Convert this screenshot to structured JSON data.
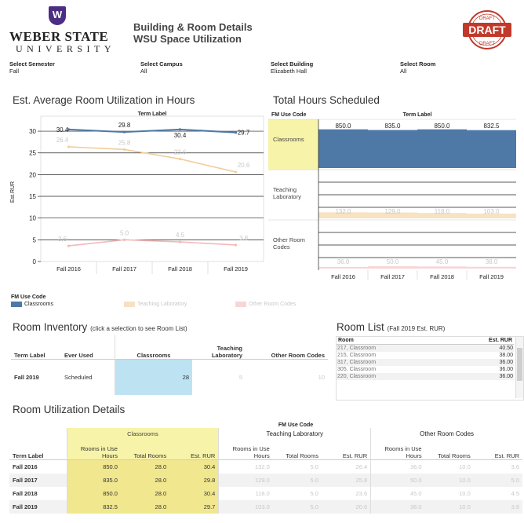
{
  "header": {
    "logo_name": "WEBER STATE",
    "logo_sub": "UNIVERSITY",
    "logo_letter": "W",
    "title1": "Building & Room Details",
    "title2": "WSU Space Utilization",
    "draft_stamp": "DRAFT",
    "draft_small": "DRAFT"
  },
  "filters": [
    {
      "label": "Select Semester",
      "value": "Fall"
    },
    {
      "label": "Select Campus",
      "value": "All"
    },
    {
      "label": "Select Building",
      "value": "Elizabeth Hall"
    },
    {
      "label": "Select Room",
      "value": "All"
    }
  ],
  "line_chart": {
    "title": "Est. Average Room Utilization in Hours",
    "header": "Term Label",
    "ylabel": "Est.RUR"
  },
  "bar_chart": {
    "title": "Total Hours Scheduled",
    "row_header": "FM Use Code",
    "col_header": "Term Label",
    "rows": [
      "Classrooms",
      "Teaching Laboratory",
      "Other Room Codes"
    ]
  },
  "legend": {
    "title": "FM Use Code",
    "items": [
      "Classrooms",
      "Teaching Laboratory",
      "Other Room Codes"
    ]
  },
  "chart_data": [
    {
      "type": "line",
      "x": [
        "Fall 2016",
        "Fall 2017",
        "Fall 2018",
        "Fall 2019"
      ],
      "ylim": [
        0,
        32
      ],
      "yticks": [
        0,
        5,
        10,
        15,
        20,
        25,
        30
      ],
      "series": [
        {
          "name": "Classrooms",
          "values": [
            30.4,
            29.8,
            30.4,
            29.7
          ],
          "labels": [
            "30.4",
            "29.8",
            "30.4",
            "29.7"
          ],
          "color": "#4e79a7"
        },
        {
          "name": "Teaching Laboratory",
          "values": [
            26.4,
            25.8,
            23.6,
            20.6
          ],
          "labels": [
            "26.4",
            "25.8",
            "23.6",
            "20.6"
          ],
          "color": "#f1ce99"
        },
        {
          "name": "Other Room Codes",
          "values": [
            3.6,
            5.0,
            4.5,
            3.8
          ],
          "labels": [
            "3.6",
            "5.0",
            "4.5",
            "3.8"
          ],
          "color": "#f4b8b8"
        }
      ]
    },
    {
      "type": "bar",
      "x": [
        "Fall 2016",
        "Fall 2017",
        "Fall 2018",
        "Fall 2019"
      ],
      "series": [
        {
          "name": "Classrooms",
          "values": [
            850.0,
            835.0,
            850.0,
            832.5
          ],
          "labels": [
            "850.0",
            "835.0",
            "850.0",
            "832.5"
          ],
          "color": "#4e79a7"
        },
        {
          "name": "Teaching Laboratory",
          "values": [
            132.0,
            129.0,
            118.0,
            103.0
          ],
          "labels": [
            "132.0",
            "129.0",
            "118.0",
            "103.0"
          ],
          "color": "#f1ce99"
        },
        {
          "name": "Other Room Codes",
          "values": [
            36.0,
            50.0,
            45.0,
            38.0
          ],
          "labels": [
            "36.0",
            "50.0",
            "45.0",
            "38.0"
          ],
          "color": "#f4b8b8"
        }
      ]
    }
  ],
  "inventory": {
    "title": "Room Inventory",
    "subtitle": "(click a selection to see Room List)",
    "headers": [
      "Term Label",
      "Ever Used",
      "Classrooms",
      "Teaching Laboratory",
      "Other Room Codes"
    ],
    "row": [
      "Fall 2019",
      "Scheduled",
      "28",
      "5",
      "10"
    ]
  },
  "room_list": {
    "title": "Room List",
    "subtitle": "(Fall 2019 Est. RUR)",
    "headers": [
      "Room",
      "Est. RUR"
    ],
    "rows": [
      [
        "217, Classroom",
        "40.50"
      ],
      [
        "215, Classroom",
        "38.00"
      ],
      [
        "317, Classroom",
        "36.00"
      ],
      [
        "305, Classroom",
        "36.00"
      ],
      [
        "220, Classroom",
        "36.00"
      ]
    ]
  },
  "details": {
    "title": "Room Utilization Details",
    "top_header": "FM Use Code",
    "groups": [
      "Classrooms",
      "Teaching Laboratory",
      "Other Room Codes"
    ],
    "term_header": "Term Label",
    "cols": [
      "Rooms in Use Hours",
      "Total Rooms",
      "Est. RUR"
    ],
    "rows": [
      {
        "term": "Fall 2016",
        "vals": [
          "850.0",
          "28.0",
          "30.4",
          "132.0",
          "5.0",
          "26.4",
          "36.0",
          "10.0",
          "3.6"
        ]
      },
      {
        "term": "Fall 2017",
        "vals": [
          "835.0",
          "28.0",
          "29.8",
          "129.0",
          "5.0",
          "25.8",
          "50.0",
          "10.0",
          "5.0"
        ]
      },
      {
        "term": "Fall 2018",
        "vals": [
          "850.0",
          "28.0",
          "30.4",
          "118.0",
          "5.0",
          "23.6",
          "45.0",
          "10.0",
          "4.5"
        ]
      },
      {
        "term": "Fall 2019",
        "vals": [
          "832.5",
          "28.0",
          "29.7",
          "103.0",
          "5.0",
          "20.6",
          "38.0",
          "10.0",
          "3.8"
        ]
      }
    ]
  }
}
